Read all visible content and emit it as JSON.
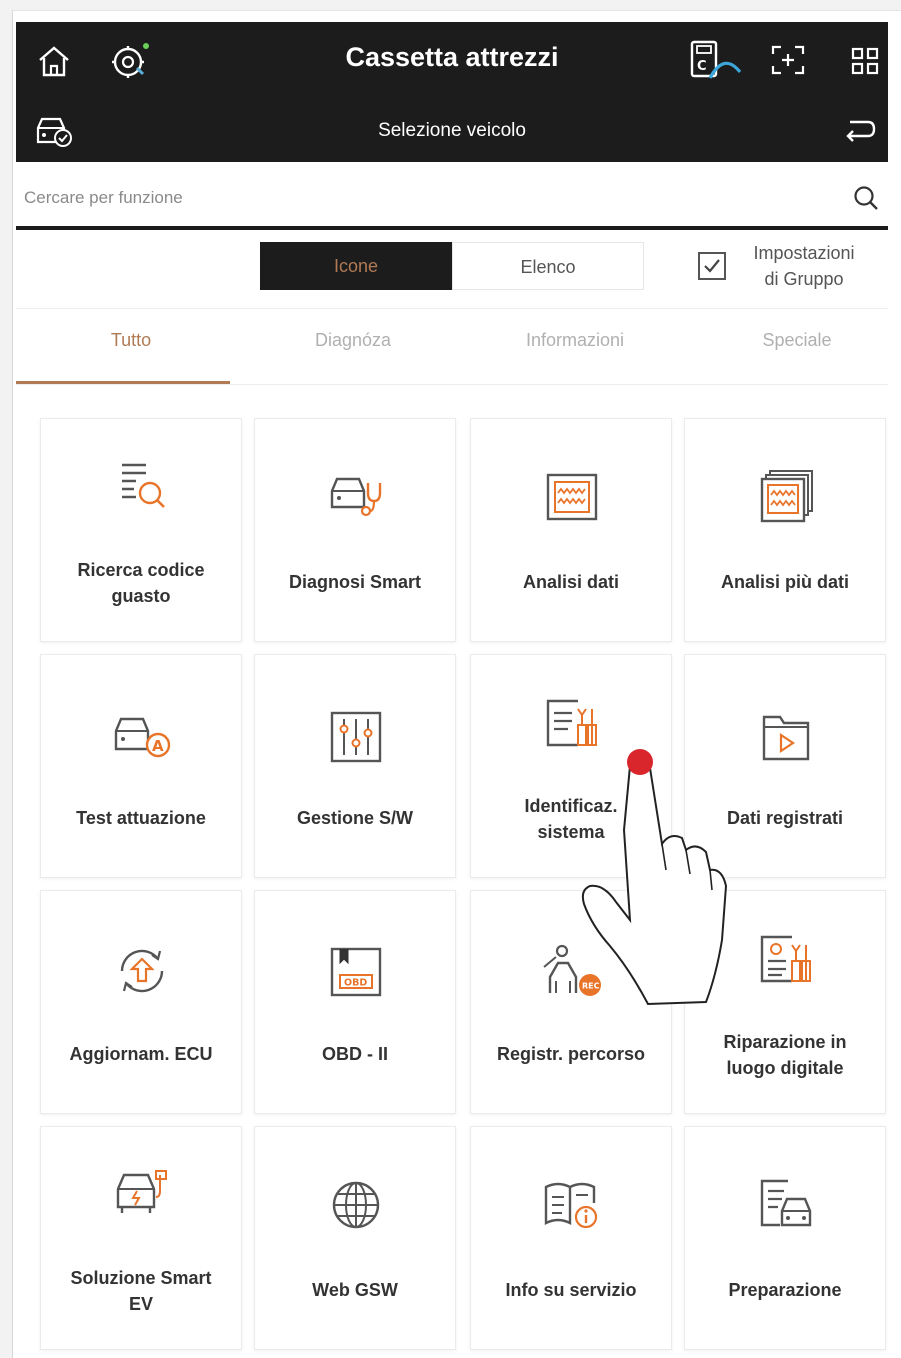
{
  "header": {
    "title": "Cassetta attrezzi",
    "subtitle": "Selezione veicolo"
  },
  "search": {
    "placeholder": "Cercare per funzione"
  },
  "view_toggle": {
    "icons_label": "Icone",
    "list_label": "Elenco",
    "selected": "Icone"
  },
  "group_settings": {
    "line1": "Impostazioni",
    "line2": "di Gruppo",
    "checked": true
  },
  "tabs": [
    {
      "label": "Tutto",
      "active": true
    },
    {
      "label": "Diagnóza",
      "active": false
    },
    {
      "label": "Informazioni",
      "active": false
    },
    {
      "label": "Speciale",
      "active": false
    }
  ],
  "tools": [
    {
      "line1": "Ricerca codice",
      "line2": "guasto",
      "icon": "dtc-search-icon"
    },
    {
      "line1": "Diagnosi Smart",
      "line2": "",
      "icon": "smart-diagnosis-icon"
    },
    {
      "line1": "Analisi dati",
      "line2": "",
      "icon": "data-analysis-icon"
    },
    {
      "line1": "Analisi più dati",
      "line2": "",
      "icon": "multi-data-analysis-icon"
    },
    {
      "line1": "Test attuazione",
      "line2": "",
      "icon": "actuation-test-icon"
    },
    {
      "line1": "Gestione S/W",
      "line2": "",
      "icon": "software-management-icon"
    },
    {
      "line1": "Identificaz.",
      "line2": "sistema",
      "icon": "system-identification-icon"
    },
    {
      "line1": "Dati registrati",
      "line2": "",
      "icon": "recorded-data-icon"
    },
    {
      "line1": "Aggiornam. ECU",
      "line2": "",
      "icon": "ecu-update-icon"
    },
    {
      "line1": "OBD - II",
      "line2": "",
      "icon": "obd-icon"
    },
    {
      "line1": "Registr. percorso",
      "line2": "",
      "icon": "route-recording-icon"
    },
    {
      "line1": "Riparazione in",
      "line2": "luogo digitale",
      "icon": "digital-repair-icon"
    },
    {
      "line1": "Soluzione Smart",
      "line2": "EV",
      "icon": "smart-ev-icon"
    },
    {
      "line1": "Web GSW",
      "line2": "",
      "icon": "globe-icon"
    },
    {
      "line1": "Info su servizio",
      "line2": "",
      "icon": "service-info-icon"
    },
    {
      "line1": "Preparazione",
      "line2": "",
      "icon": "preparation-icon"
    }
  ],
  "icon_text": {
    "obd": "OBD",
    "rec": "REC"
  },
  "colors": {
    "bar": "#1c1c1c",
    "accent": "#b07a55",
    "icon_orange": "#e8742a",
    "tap_dot": "#d9262c"
  }
}
